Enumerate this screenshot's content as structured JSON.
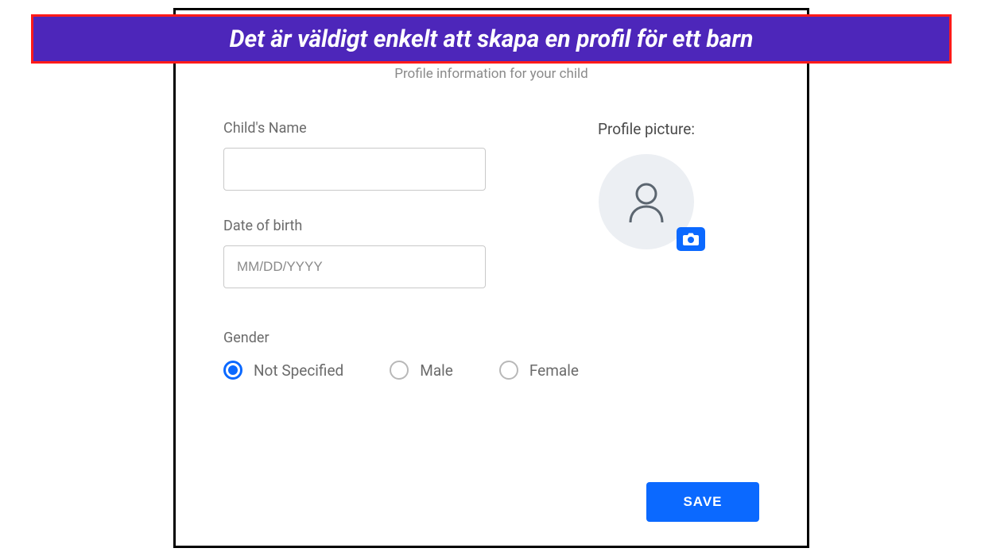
{
  "banner": {
    "text": "Det är väldigt enkelt att skapa en profil för ett barn"
  },
  "subtitle": "Profile information for your child",
  "form": {
    "name_label": "Child's Name",
    "name_value": "",
    "dob_label": "Date of birth",
    "dob_placeholder": "MM/DD/YYYY",
    "dob_value": "",
    "gender_label": "Gender",
    "gender_options": {
      "not_specified": "Not Specified",
      "male": "Male",
      "female": "Female"
    },
    "gender_selected": "not_specified"
  },
  "profile_picture_label": "Profile picture:",
  "save_label": "SAVE",
  "colors": {
    "accent": "#0b69ff",
    "banner_bg": "#4d26ba",
    "banner_border": "#ff1a1a"
  }
}
